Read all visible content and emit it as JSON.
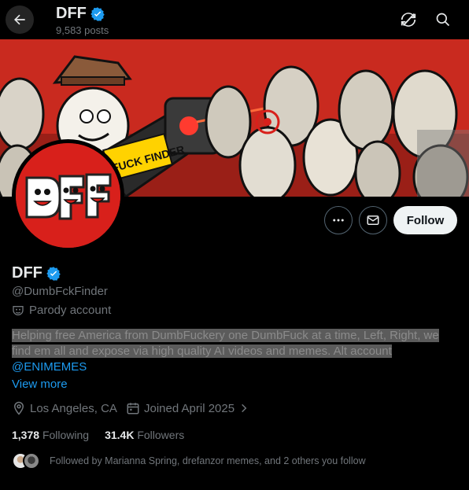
{
  "header": {
    "title": "DFF",
    "posts_count": "9,583 posts",
    "icons": [
      "back-arrow-icon",
      "refresh-slash-icon",
      "search-icon"
    ]
  },
  "banner": {
    "sign_text": "FUCK FINDER",
    "colors": {
      "background": "#d62a1e",
      "laser": "#ff3b2f"
    }
  },
  "avatar": {
    "logo_text": "DFF",
    "colors": {
      "background": "#d8201b"
    }
  },
  "actions": {
    "more_icon": "more-dots-icon",
    "message_icon": "mail-icon",
    "follow_label": "Follow"
  },
  "profile": {
    "name": "DFF",
    "handle": "@DumbFckFinder",
    "label": "Parody account",
    "bio_line1": "Helping free America from DumbFuckery one DumbFuck at a time, Left, Right, we",
    "bio_line2": "find em all and expose via high quality AI videos and memes. Alt account",
    "bio_mention": "@ENIMEMES",
    "view_more": "View more",
    "location": "Los Angeles, CA",
    "joined": "Joined April 2025"
  },
  "stats": {
    "following_count": "1,378",
    "following_label": "Following",
    "followers_count": "31.4K",
    "followers_label": "Followers"
  },
  "followed_by": "Followed by Marianna Spring, drefanzor memes, and 2 others you follow",
  "colors": {
    "accent": "#1d9bf0",
    "verified": "#1d9bf0",
    "muted": "#71767b"
  }
}
